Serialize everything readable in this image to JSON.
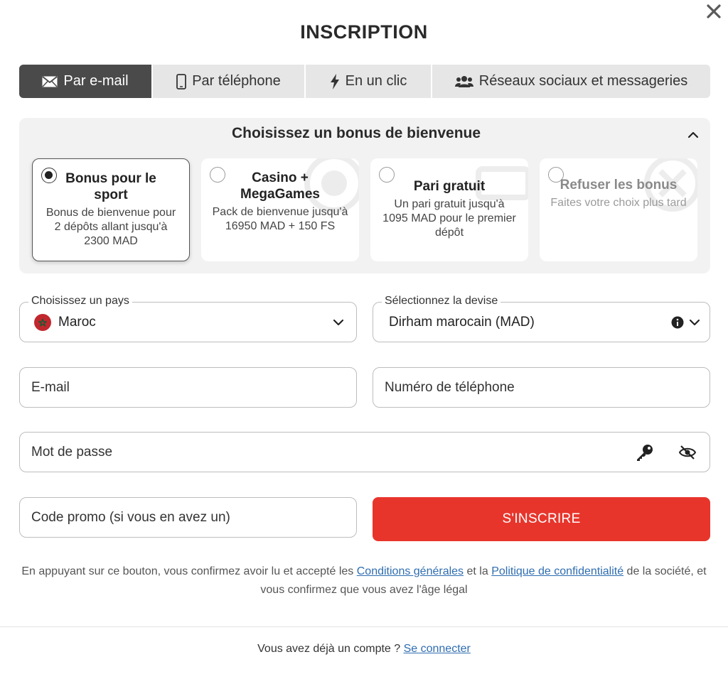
{
  "header": {
    "title": "INSCRIPTION",
    "close_icon": "close-icon"
  },
  "tabs": [
    {
      "label": "Par e-mail",
      "icon": "envelope-icon",
      "active": true
    },
    {
      "label": "Par téléphone",
      "icon": "mobile-phone-icon",
      "active": false
    },
    {
      "label": "En un clic",
      "icon": "lightning-icon",
      "active": false
    },
    {
      "label": "Réseaux sociaux et messageries",
      "icon": "users-icon",
      "active": false
    }
  ],
  "bonus": {
    "title": "Choisissez un bonus de bienvenue",
    "options": [
      {
        "title": "Bonus pour le sport",
        "description": "Bonus de bienvenue pour 2 dépôts allant jusqu'à 2300 MAD",
        "selected": true
      },
      {
        "title": "Casino + MegaGames",
        "description": "Pack de bienvenue jusqu'à 16950 MAD + 150 FS",
        "selected": false
      },
      {
        "title": "Pari gratuit",
        "description": "Un pari gratuit jusqu'à 1095 MAD pour le premier dépôt",
        "selected": false
      },
      {
        "title": "Refuser les bonus",
        "description": "Faites votre choix plus tard",
        "selected": false
      }
    ]
  },
  "form": {
    "country_label": "Choisissez un pays",
    "country_value": "Maroc",
    "currency_label": "Sélectionnez la devise",
    "currency_value": "Dirham marocain (MAD)",
    "email_placeholder": "E-mail",
    "phone_placeholder": "Numéro de téléphone",
    "password_placeholder": "Mot de passe",
    "promo_placeholder": "Code promo (si vous en avez un)",
    "submit_label": "S'INSCRIRE"
  },
  "terms": {
    "prefix": "En appuyant sur ce bouton, vous confirmez avoir lu et accepté les ",
    "link1": "Conditions générales",
    "middle": " et la ",
    "link2": "Politique de confidentialité",
    "suffix": " de la société, et vous confirmez que vous avez l'âge légal"
  },
  "footer": {
    "prompt": "Vous avez déjà un compte ? ",
    "login_link": "Se connecter"
  },
  "colors": {
    "accent": "#e8352c",
    "active_tab": "#4a4a4a",
    "link": "#2f6db0",
    "panel": "#f2f2f2"
  }
}
